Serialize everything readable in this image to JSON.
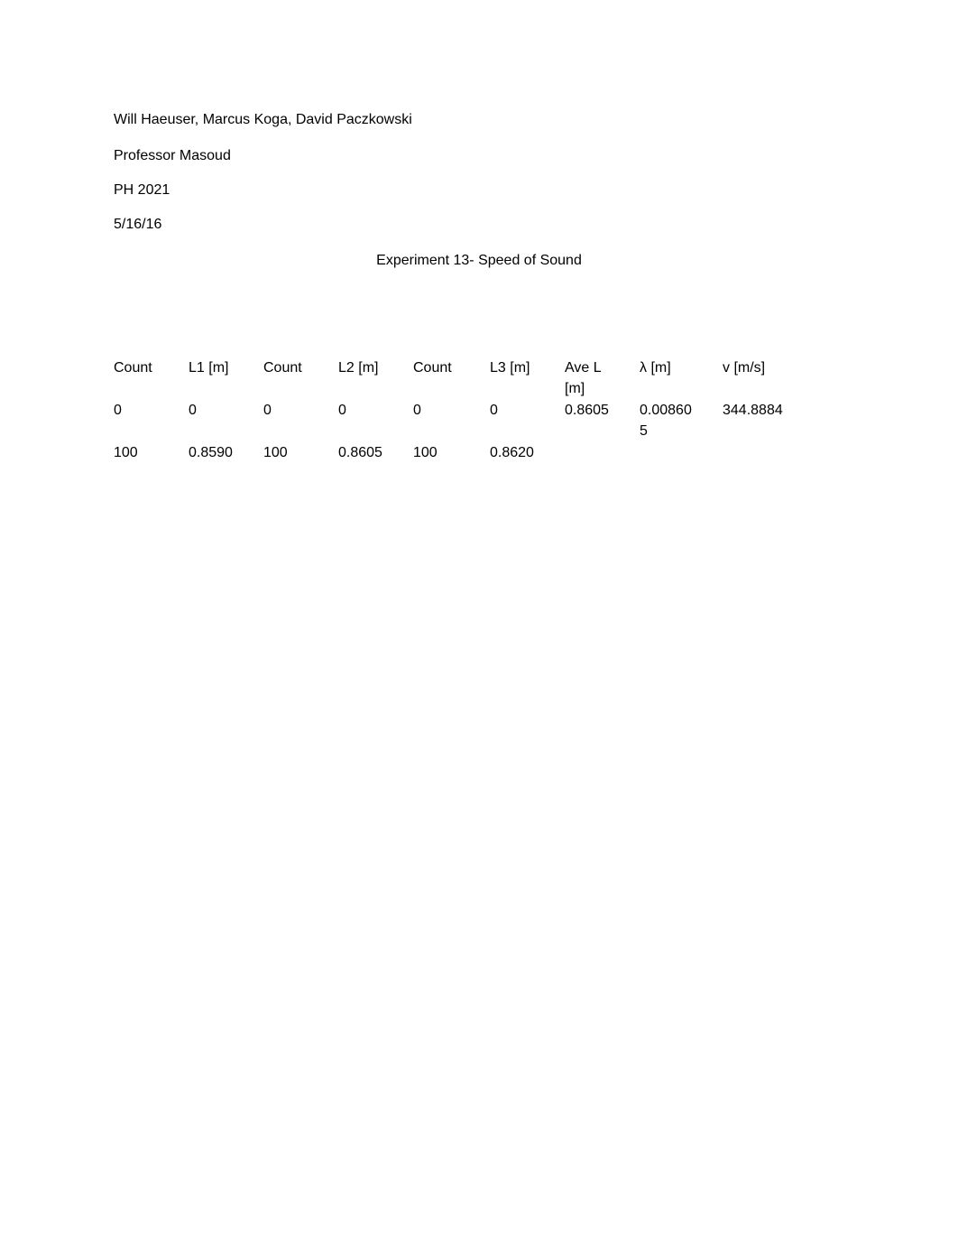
{
  "header": {
    "authors": "Will Haeuser, Marcus Koga, David Paczkowski",
    "professor": "Professor Masoud",
    "course": "PH 2021",
    "date": "5/16/16"
  },
  "title": "Experiment 13- Speed of Sound",
  "table": {
    "columns": [
      "Count",
      "L1 [m]",
      "Count",
      "L2 [m]",
      "Count",
      "L3 [m]",
      "Ave L [m]",
      "λ  [m]",
      "v [m/s]"
    ],
    "rows": [
      [
        "0",
        "0",
        "0",
        "0",
        "0",
        "0",
        "0.8605",
        "0.008605",
        "344.8884"
      ],
      [
        "100",
        "0.8590",
        "100",
        "0.8605",
        "100",
        "0.8620",
        "",
        "",
        ""
      ]
    ]
  }
}
